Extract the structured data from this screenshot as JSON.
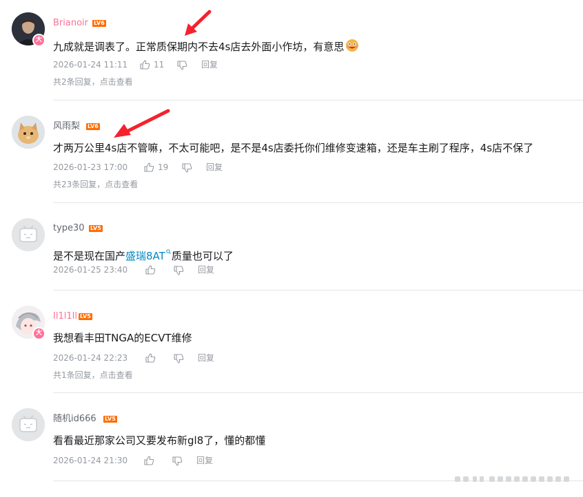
{
  "comments": [
    {
      "user": "Brianoir",
      "user_color": "#fb7299",
      "level": "LV6",
      "vip_badge": "大",
      "text": "九成就是调表了。正常质保期内不去4s店去外面小作坊，有意思",
      "emoji": "doge-laugh-emoji",
      "time": "2026-01-24 11:11",
      "likes": "11",
      "reply_label": "回复",
      "replies_info": "共2条回复，点击查看"
    },
    {
      "user": "风雨梨",
      "user_color": "#61666d",
      "level": "LV6",
      "text": "才两万公里4s店不管嘛，不太可能吧，是不是4s店委托你们维修变速箱，还是车主刷了程序，4s店不保了",
      "time": "2026-01-23 17:00",
      "likes": "19",
      "reply_label": "回复",
      "replies_info": "共23条回复，点击查看"
    },
    {
      "user": "type30",
      "user_color": "#61666d",
      "level": "LV5",
      "text_before": "是不是现在国产",
      "jump_link": "盛瑞8AT",
      "text_after": "质量也可以了",
      "time": "2026-01-25 23:40",
      "likes": "",
      "reply_label": "回复"
    },
    {
      "user": "Il1l1Il",
      "user_color": "#fb7299",
      "level": "LV5",
      "vip_badge": "大",
      "text": "我想看丰田TNGA的ECVT维修",
      "time": "2026-01-24 22:23",
      "likes": "",
      "reply_label": "回复",
      "replies_info": "共1条回复，点击查看"
    },
    {
      "user": "随机id666",
      "user_color": "#61666d",
      "level": "LV5",
      "text": "看看最近那家公司又要发布新gl8了，懂的都懂",
      "time": "2026-01-24 21:30",
      "likes": "",
      "reply_label": "回复"
    }
  ],
  "colors": {
    "vip_pink": "#fb7299",
    "level_orange": "#ff6c00",
    "meta_gray": "#9499a0",
    "link_blue": "#008ac5",
    "annotation_red": "#f5222d"
  }
}
